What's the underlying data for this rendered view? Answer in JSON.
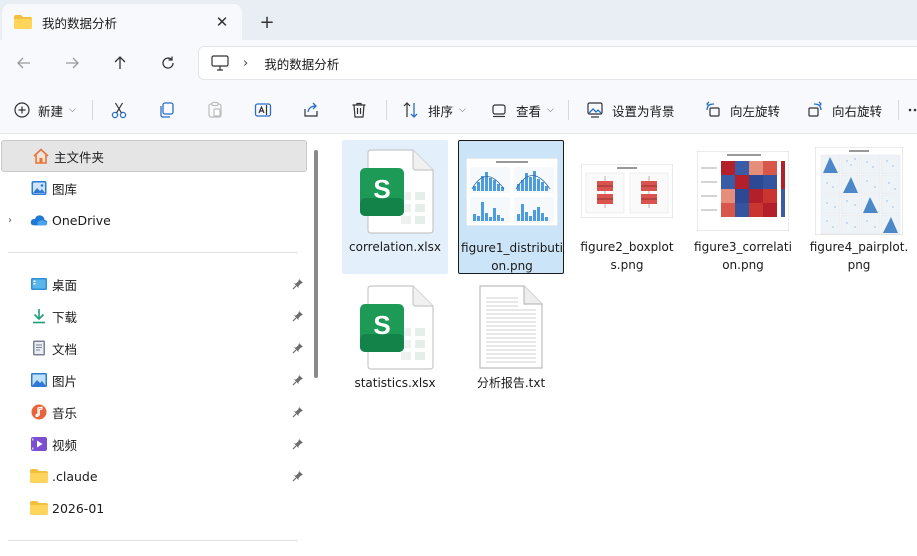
{
  "tab": {
    "title": "我的数据分析",
    "close": "✕",
    "new": "+"
  },
  "address": {
    "separator": "›",
    "crumb": "我的数据分析"
  },
  "toolbar": {
    "new_label": "新建",
    "sort_label": "排序",
    "view_label": "查看",
    "set_bg_label": "设置为背景",
    "rotate_left_label": "向左旋转",
    "rotate_right_label": "向右旋转",
    "caret": "⌵"
  },
  "sidebar": {
    "top": [
      {
        "label": "主文件夹",
        "icon": "home-icon"
      },
      {
        "label": "图库",
        "icon": "gallery-icon"
      },
      {
        "label": "OneDrive",
        "icon": "cloud-icon",
        "chevron": "›"
      }
    ],
    "quick": [
      {
        "label": "桌面",
        "icon": "desktop-icon"
      },
      {
        "label": "下载",
        "icon": "download-icon"
      },
      {
        "label": "文档",
        "icon": "document-icon"
      },
      {
        "label": "图片",
        "icon": "pictures-icon"
      },
      {
        "label": "音乐",
        "icon": "music-icon"
      },
      {
        "label": "视频",
        "icon": "video-icon"
      },
      {
        "label": ".claude",
        "icon": "folder-icon"
      },
      {
        "label": "2026-01",
        "icon": "folder-icon"
      }
    ]
  },
  "files": [
    {
      "name": "correlation.xlsx",
      "type": "excel",
      "state": "hover"
    },
    {
      "name": "figure1_distribution.png",
      "type": "image",
      "state": "selected"
    },
    {
      "name": "figure2_boxplots.png",
      "type": "image",
      "state": "normal"
    },
    {
      "name": "figure3_correlation.png",
      "type": "image",
      "state": "normal"
    },
    {
      "name": "figure4_pairplot.png",
      "type": "image",
      "state": "normal"
    },
    {
      "name": "statistics.xlsx",
      "type": "excel",
      "state": "normal"
    },
    {
      "name": "分析报告.txt",
      "type": "text",
      "state": "normal"
    }
  ],
  "colors": {
    "accent": "#0067c0",
    "selected_bg": "#cce4f7",
    "hover_bg": "#e3f0fc",
    "excel_green": "#1d9a55"
  }
}
